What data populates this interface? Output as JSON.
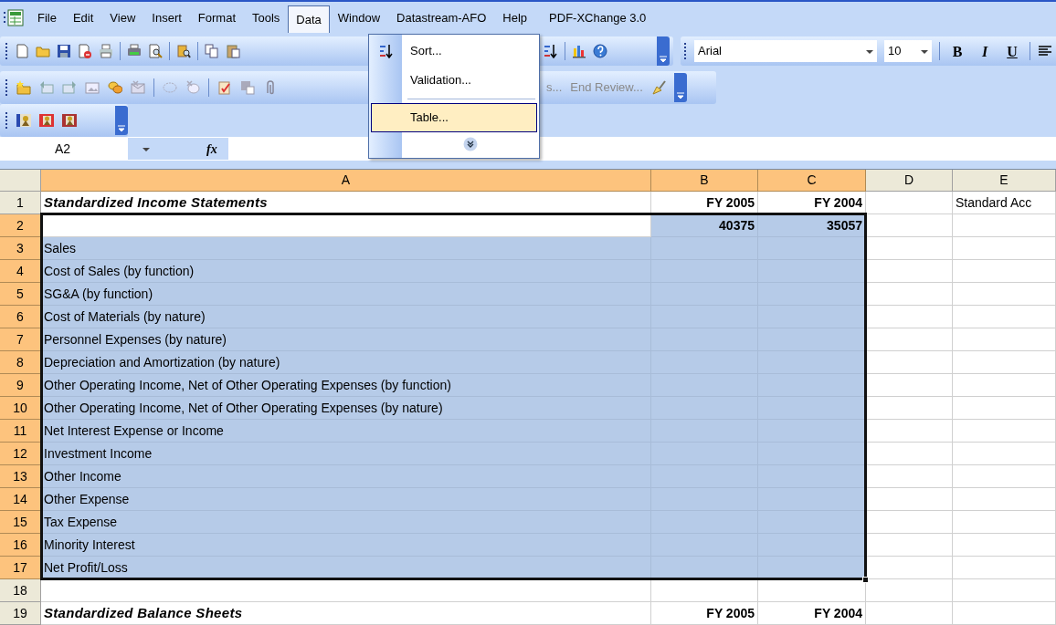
{
  "menu_bar": [
    {
      "label": "File",
      "open": false
    },
    {
      "label": "Edit",
      "open": false
    },
    {
      "label": "View",
      "open": false
    },
    {
      "label": "Insert",
      "open": false
    },
    {
      "label": "Format",
      "open": false
    },
    {
      "label": "Tools",
      "open": false
    },
    {
      "label": "Data",
      "open": true
    },
    {
      "label": "Window",
      "open": false
    },
    {
      "label": "Datastream-AFO",
      "open": false
    },
    {
      "label": "Help",
      "open": false
    },
    {
      "label": "PDF-XChange 3.0",
      "open": false
    }
  ],
  "data_menu": [
    {
      "kind": "command",
      "label": "Sort...",
      "selected": false
    },
    {
      "kind": "command",
      "label": "Validation...",
      "selected": false
    },
    {
      "kind": "separator"
    },
    {
      "kind": "command",
      "label": "Table...",
      "selected": true
    },
    {
      "kind": "expand"
    }
  ],
  "formatting_toolbar": {
    "font": "Arial",
    "size": "10",
    "bold": "B",
    "italic": "I",
    "underline": "U"
  },
  "reviewing_toolbar": {
    "partial_label": "s...",
    "end_review": {
      "label": "End Review...",
      "disabled": true
    }
  },
  "formula_bar": {
    "name_box": "A2",
    "function_label": "fx"
  },
  "columns": [
    {
      "label": "A",
      "selected": true
    },
    {
      "label": "B",
      "selected": true
    },
    {
      "label": "C",
      "selected": true
    },
    {
      "label": "D",
      "selected": false
    },
    {
      "label": "E",
      "selected": false
    }
  ],
  "rows": [
    {
      "number": "1",
      "kind": "heading",
      "selected": false,
      "cells": [
        {
          "text": "Standardized Income Statements"
        },
        {
          "text": "FY 2005"
        },
        {
          "text": "FY 2004"
        },
        {},
        {
          "text": "Standard Acc"
        }
      ]
    },
    {
      "number": "2",
      "kind": "values",
      "selected": true,
      "cells": [
        {
          "active": true
        },
        {
          "text": "40375"
        },
        {
          "text": "35057"
        },
        {},
        {}
      ]
    },
    {
      "number": "3",
      "kind": "item",
      "selected": true,
      "cells": [
        {
          "text": "Sales"
        },
        {},
        {},
        {},
        {}
      ]
    },
    {
      "number": "4",
      "kind": "item",
      "selected": true,
      "cells": [
        {
          "text": "Cost of Sales (by function)"
        },
        {},
        {},
        {},
        {}
      ]
    },
    {
      "number": "5",
      "kind": "item",
      "selected": true,
      "cells": [
        {
          "text": "SG&A (by function)"
        },
        {},
        {},
        {},
        {}
      ]
    },
    {
      "number": "6",
      "kind": "item",
      "selected": true,
      "cells": [
        {
          "text": "Cost of Materials (by nature)"
        },
        {},
        {},
        {},
        {}
      ]
    },
    {
      "number": "7",
      "kind": "item",
      "selected": true,
      "cells": [
        {
          "text": "Personnel Expenses (by nature)"
        },
        {},
        {},
        {},
        {}
      ]
    },
    {
      "number": "8",
      "kind": "item",
      "selected": true,
      "cells": [
        {
          "text": "Depreciation and Amortization (by nature)"
        },
        {},
        {},
        {},
        {}
      ]
    },
    {
      "number": "9",
      "kind": "item",
      "selected": true,
      "cells": [
        {
          "text": "Other Operating Income, Net of Other Operating Expenses (by function)"
        },
        {},
        {},
        {},
        {}
      ]
    },
    {
      "number": "10",
      "kind": "item",
      "selected": true,
      "cells": [
        {
          "text": "Other Operating Income, Net of Other Operating Expenses (by nature)"
        },
        {},
        {},
        {},
        {}
      ]
    },
    {
      "number": "11",
      "kind": "item",
      "selected": true,
      "cells": [
        {
          "text": "Net Interest Expense or Income"
        },
        {},
        {},
        {},
        {}
      ]
    },
    {
      "number": "12",
      "kind": "item",
      "selected": true,
      "cells": [
        {
          "text": "Investment Income"
        },
        {},
        {},
        {},
        {}
      ]
    },
    {
      "number": "13",
      "kind": "item",
      "selected": true,
      "cells": [
        {
          "text": "Other Income"
        },
        {},
        {},
        {},
        {}
      ]
    },
    {
      "number": "14",
      "kind": "item",
      "selected": true,
      "cells": [
        {
          "text": "Other Expense"
        },
        {},
        {},
        {},
        {}
      ]
    },
    {
      "number": "15",
      "kind": "item",
      "selected": true,
      "cells": [
        {
          "text": "Tax Expense"
        },
        {},
        {},
        {},
        {}
      ]
    },
    {
      "number": "16",
      "kind": "item",
      "selected": true,
      "cells": [
        {
          "text": "Minority Interest"
        },
        {},
        {},
        {},
        {}
      ]
    },
    {
      "number": "17",
      "kind": "item",
      "selected": true,
      "cells": [
        {
          "text": "Net Profit/Loss"
        },
        {},
        {},
        {},
        {}
      ]
    },
    {
      "number": "18",
      "kind": "item",
      "selected": false,
      "cells": [
        {},
        {},
        {},
        {},
        {}
      ]
    },
    {
      "number": "19",
      "kind": "heading",
      "selected": false,
      "cells": [
        {
          "text": "Standardized Balance Sheets"
        },
        {
          "text": "FY 2005"
        },
        {
          "text": "FY 2004"
        },
        {},
        {}
      ]
    }
  ]
}
